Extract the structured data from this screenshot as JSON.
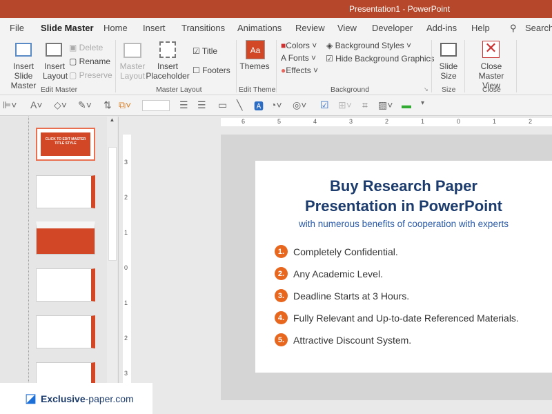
{
  "window": {
    "title": "Presentation1  -  PowerPoint"
  },
  "tabs": [
    "File",
    "Slide Master",
    "Home",
    "Insert",
    "Transitions",
    "Animations",
    "Review",
    "View",
    "Developer",
    "Add-ins",
    "Help"
  ],
  "search": "Search",
  "ribbon": {
    "insert_slide_master": "Insert Slide Master",
    "insert_layout": "Insert Layout",
    "delete": "Delete",
    "rename": "Rename",
    "preserve": "Preserve",
    "edit_master": "Edit Master",
    "master_layout_btn": "Master Layout",
    "insert_placeholder": "Insert Placeholder",
    "title": "Title",
    "footers": "Footers",
    "master_layout": "Master Layout",
    "themes": "Themes",
    "edit_theme": "Edit Theme",
    "colors": "Colors",
    "fonts": "Fonts",
    "effects": "Effects",
    "background_styles": "Background Styles",
    "hide_bg": "Hide Background Graphics",
    "background": "Background",
    "slide_size": "Slide Size",
    "size": "Size",
    "close_master": "Close Master View",
    "close": "Close",
    "title_checked": true,
    "footers_checked": false,
    "hide_bg_checked": true
  },
  "ruler": {
    "h": [
      "6",
      "5",
      "4",
      "3",
      "2",
      "1",
      "0",
      "1",
      "2"
    ],
    "v": [
      "3",
      "2",
      "1",
      "0",
      "1",
      "2",
      "3"
    ]
  },
  "thumbnail_text": "CLICK TO EDIT MASTER TITLE STYLE",
  "slide": {
    "title_line1": "Buy Research Paper",
    "title_line2": "Presentation in PowerPoint",
    "subtitle": "with numerous benefits of cooperation with experts",
    "items": [
      {
        "n": "1.",
        "t": "Completely Confidential."
      },
      {
        "n": "2.",
        "t": "Any Academic Level."
      },
      {
        "n": "3.",
        "t": "Deadline Starts at 3 Hours."
      },
      {
        "n": "4.",
        "t": "Fully Relevant and Up-to-date Referenced Materials."
      },
      {
        "n": "5.",
        "t": "Attractive Discount System."
      }
    ]
  },
  "logo": {
    "bold": "Exclusive",
    "rest": "-paper.com"
  },
  "colors": {
    "brand": "#b7472a",
    "title": "#1d3c6e",
    "accent": "#e8671f"
  }
}
